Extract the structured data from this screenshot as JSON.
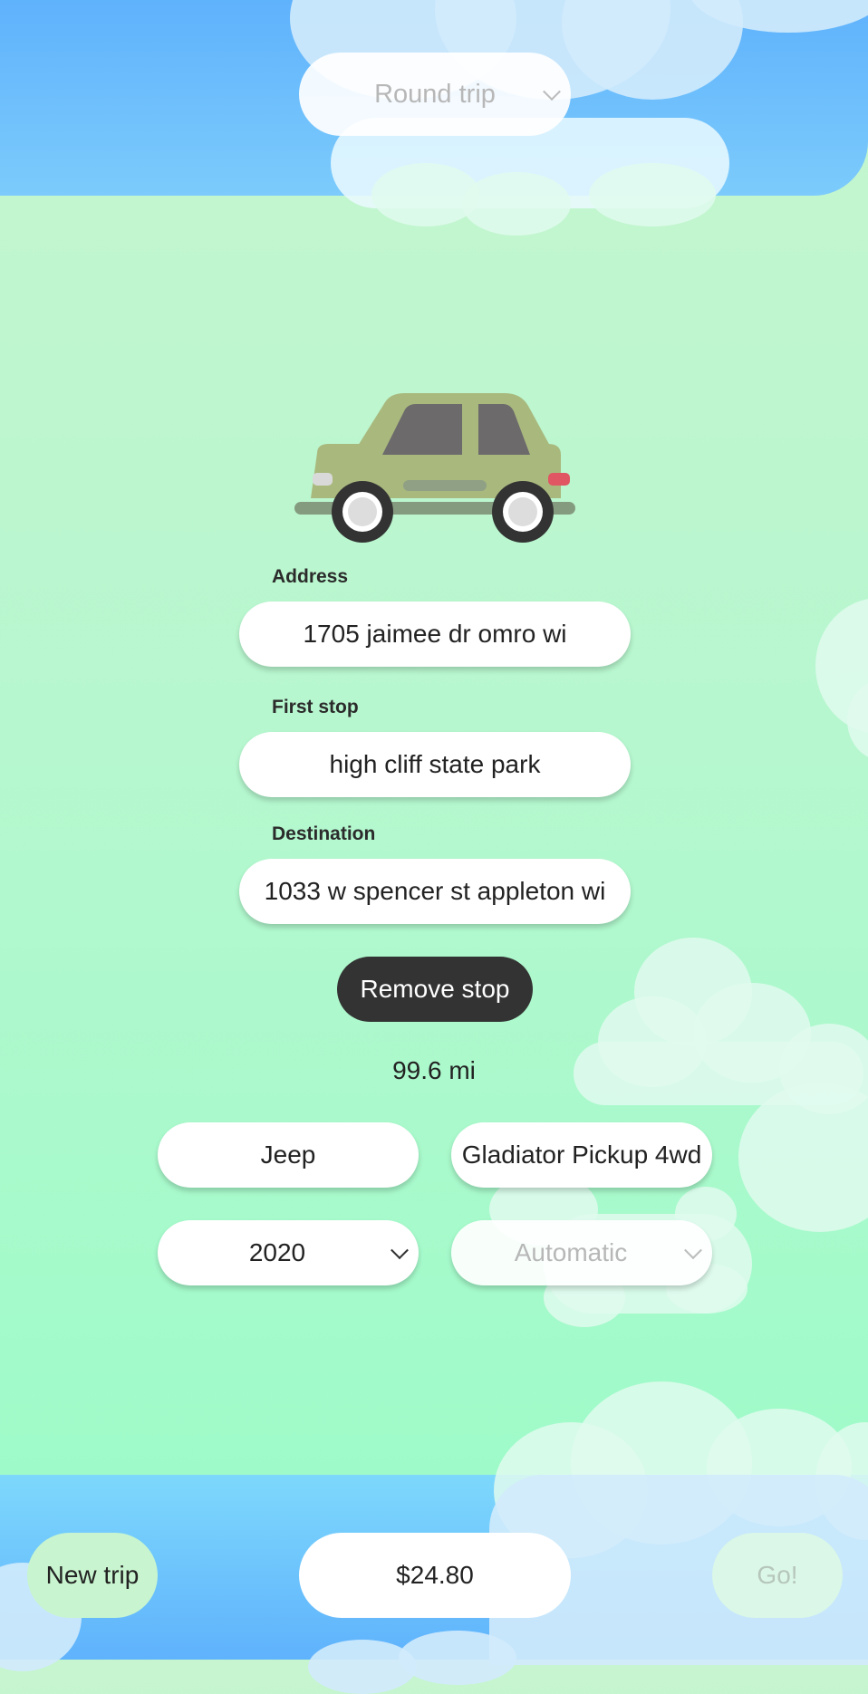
{
  "trip_type": {
    "selected": "Round trip"
  },
  "address": {
    "label": "Address",
    "value": "1705 jaimee dr omro wi"
  },
  "first_stop": {
    "label": "First stop",
    "value": "high cliff state park"
  },
  "destination": {
    "label": "Destination",
    "value": "1033 w spencer st appleton wi"
  },
  "remove_stop_label": "Remove stop",
  "distance": "99.6 mi",
  "vehicle": {
    "make": "Jeep",
    "model": "Gladiator Pickup 4wd",
    "year": "2020",
    "transmission": "Automatic"
  },
  "footer": {
    "new_trip_label": "New trip",
    "cost": "$24.80",
    "go_label": "Go!"
  },
  "colors": {
    "background_green": "#b6f7cf",
    "sky_blue": "#5fb2fc",
    "button_dark": "#333333",
    "car_body": "#a9b97e"
  }
}
